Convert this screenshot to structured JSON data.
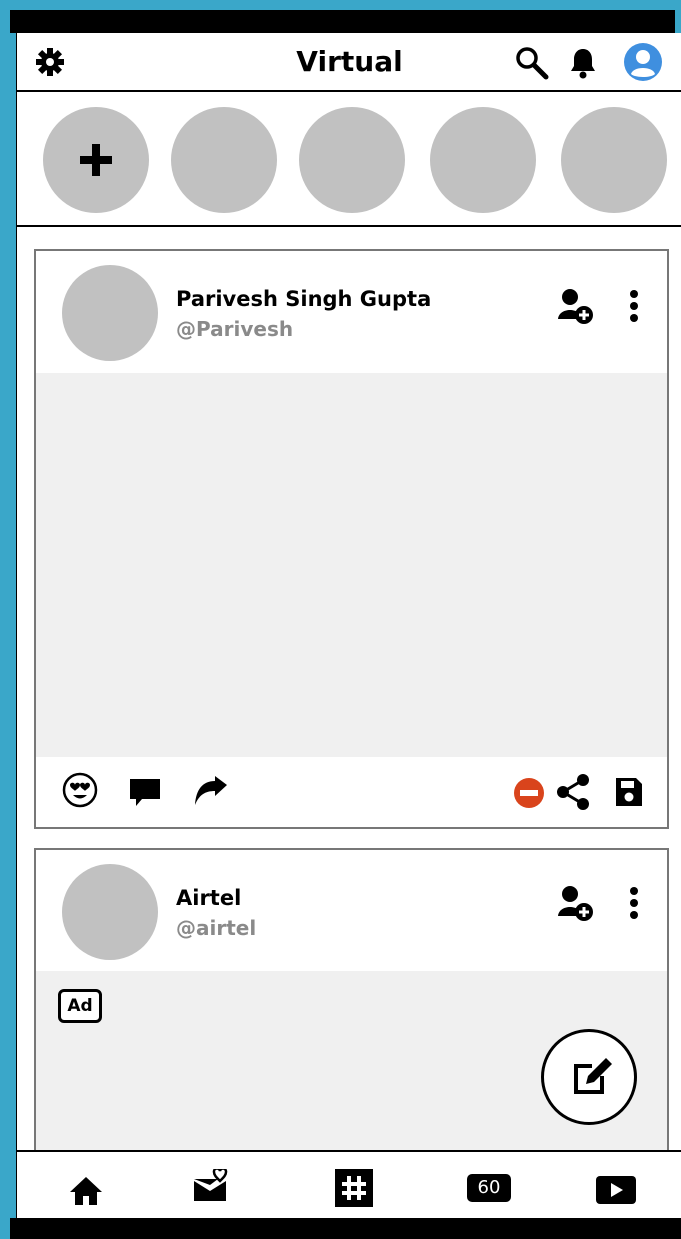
{
  "app": {
    "title": "Virtual"
  },
  "header": {
    "settings_icon": "gear-icon",
    "search_icon": "search-icon",
    "notification_icon": "bell-icon",
    "profile_icon": "user-circle-icon"
  },
  "stories": {
    "add_label": "+",
    "count": 5
  },
  "posts": [
    {
      "author": "Parivesh Singh Gupta",
      "handle": "@Parivesh",
      "actions": [
        "love-emoji-icon",
        "comment-icon",
        "share-forward-icon",
        "block-icon",
        "share-icon",
        "save-icon"
      ]
    },
    {
      "author": "Airtel",
      "handle": "@airtel",
      "ad_label": "Ad"
    }
  ],
  "nav": {
    "items": [
      "home-icon",
      "love-mail-icon",
      "hashtag-icon",
      "sixty-icon",
      "video-play-icon"
    ],
    "sixty_label": "60"
  },
  "colors": {
    "frame": "#3aa7c9",
    "placeholder": "#c1c1c1",
    "block": "#d9441c",
    "profile": "#3f8fdf"
  }
}
